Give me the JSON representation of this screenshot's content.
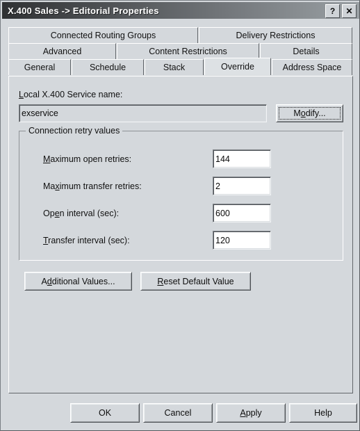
{
  "window": {
    "title": "X.400 Sales -> Editorial Properties",
    "help_button": "?",
    "close_button": "✕"
  },
  "tabs": {
    "rows": [
      [
        {
          "label": "Connected Routing Groups",
          "selected": false
        },
        {
          "label": "Delivery Restrictions",
          "selected": false
        }
      ],
      [
        {
          "label": "Advanced",
          "selected": false
        },
        {
          "label": "Content Restrictions",
          "selected": false
        },
        {
          "label": "Details",
          "selected": false
        }
      ],
      [
        {
          "label": "General",
          "selected": false
        },
        {
          "label": "Schedule",
          "selected": false
        },
        {
          "label": "Stack",
          "selected": false
        },
        {
          "label": "Override",
          "selected": true
        },
        {
          "label": "Address Space",
          "selected": false
        }
      ]
    ],
    "selected": "Override"
  },
  "override_page": {
    "service_name_label": "Local X.400 Service name:",
    "service_name_value": "exservice",
    "modify_button": "Modify...",
    "group": {
      "title": "Connection retry values",
      "fields": [
        {
          "label": "Maximum open retries:",
          "value": "144"
        },
        {
          "label": "Maximum transfer retries:",
          "value": "2"
        },
        {
          "label": "Open interval (sec):",
          "value": "600"
        },
        {
          "label": "Transfer interval (sec):",
          "value": "120"
        }
      ]
    },
    "additional_values_button": "Additional Values...",
    "reset_default_button": "Reset Default Value"
  },
  "footer": {
    "ok": "OK",
    "cancel": "Cancel",
    "apply": "Apply",
    "help": "Help"
  },
  "colors": {
    "dialog_face": "#d4d8dc",
    "titlebar_dark": "#2f3133",
    "titlebar_light": "#9aa0a4",
    "title_text": "#ffffff",
    "body_text": "#101010",
    "field_bg": "#ffffff"
  }
}
